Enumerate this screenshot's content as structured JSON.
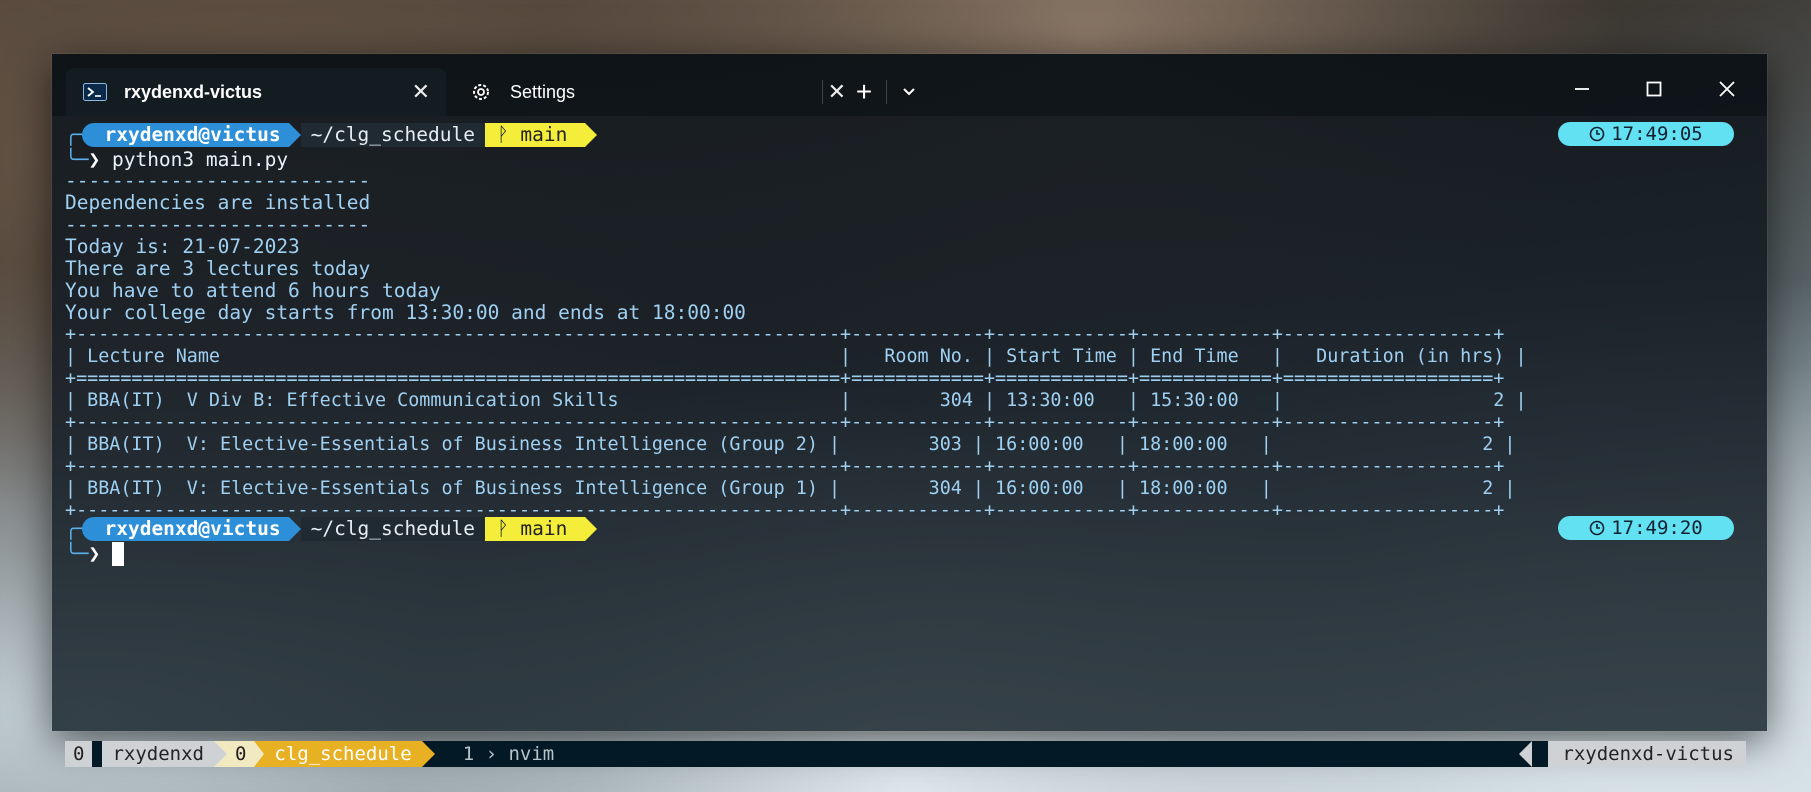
{
  "tabs": [
    {
      "label": "rxydenxd-victus",
      "icon": "powershell-icon",
      "close": "✕"
    },
    {
      "label": "Settings",
      "icon": "gear-icon",
      "close": "✕"
    }
  ],
  "tabbar": {
    "new_tab": "+",
    "dropdown": "⌄"
  },
  "window_controls": {
    "minimize": "—",
    "maximize": "☐",
    "close": "✕"
  },
  "prompt1": {
    "user": "rxydenxd@victus",
    "path": "~/clg_schedule",
    "branch_icon": "ᚹ",
    "branch": "main",
    "time": "17:49:05",
    "command": "python3 main.py"
  },
  "output": [
    "--------------------------",
    "Dependencies are installed",
    "--------------------------",
    "Today is: 21-07-2023",
    "There are 3 lectures today",
    "You have to attend 6 hours today",
    "Your college day starts from 13:30:00 and ends at 18:00:00"
  ],
  "table": {
    "border_top": "+---------------------------------------------------------------------+------------+------------+------------+-------------------+",
    "header": "| Lecture Name                                                        |   Room No. | Start Time | End Time   |   Duration (in hrs) |",
    "header_sep": "+=====================================================================+============+============+============+===================+",
    "rows": [
      "| BBA(IT)  V Div B: Effective Communication Skills                    |        304 | 13:30:00   | 15:30:00   |                   2 |",
      "| BBA(IT)  V: Elective-Essentials of Business Intelligence (Group 2) |        303 | 16:00:00   | 18:00:00   |                   2 |",
      "| BBA(IT)  V: Elective-Essentials of Business Intelligence (Group 1) |        304 | 16:00:00   | 18:00:00   |                   2 |"
    ],
    "row_sep": "+---------------------------------------------------------------------+------------+------------+------------+-------------------+"
  },
  "prompt2": {
    "user": "rxydenxd@victus",
    "path": "~/clg_schedule",
    "branch_icon": "ᚹ",
    "branch": "main",
    "time": "17:49:20"
  },
  "statusbar": {
    "session_index": "0",
    "session_name": "rxydenxd",
    "window_index": "0",
    "window_name": "clg_schedule",
    "window2_index": "1",
    "window2_name": "nvim",
    "host": "rxydenxd-victus"
  }
}
